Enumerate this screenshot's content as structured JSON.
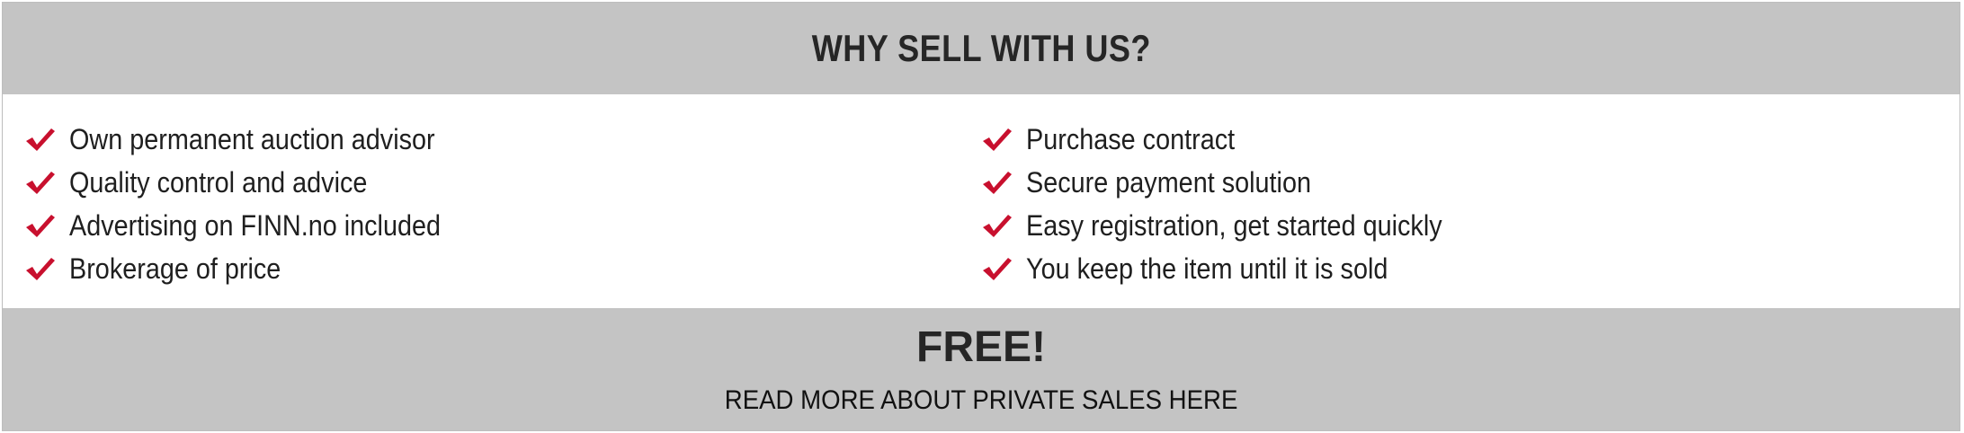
{
  "header": {
    "title": "WHY SELL WITH US?"
  },
  "features": {
    "left": [
      "Own permanent auction advisor",
      "Quality control and advice",
      "Advertising on FINN.no included",
      "Brokerage of price"
    ],
    "right": [
      "Purchase contract",
      "Secure payment solution",
      "Easy registration, get started quickly",
      "You keep the item until it is sold"
    ],
    "icon": "check-icon"
  },
  "footer": {
    "free_label": "FREE!",
    "link_label": "READ MORE ABOUT PRIVATE SALES HERE"
  },
  "colors": {
    "band_background": "#c4c4c4",
    "check_red": "#c8102e",
    "text_dark": "#262626"
  }
}
